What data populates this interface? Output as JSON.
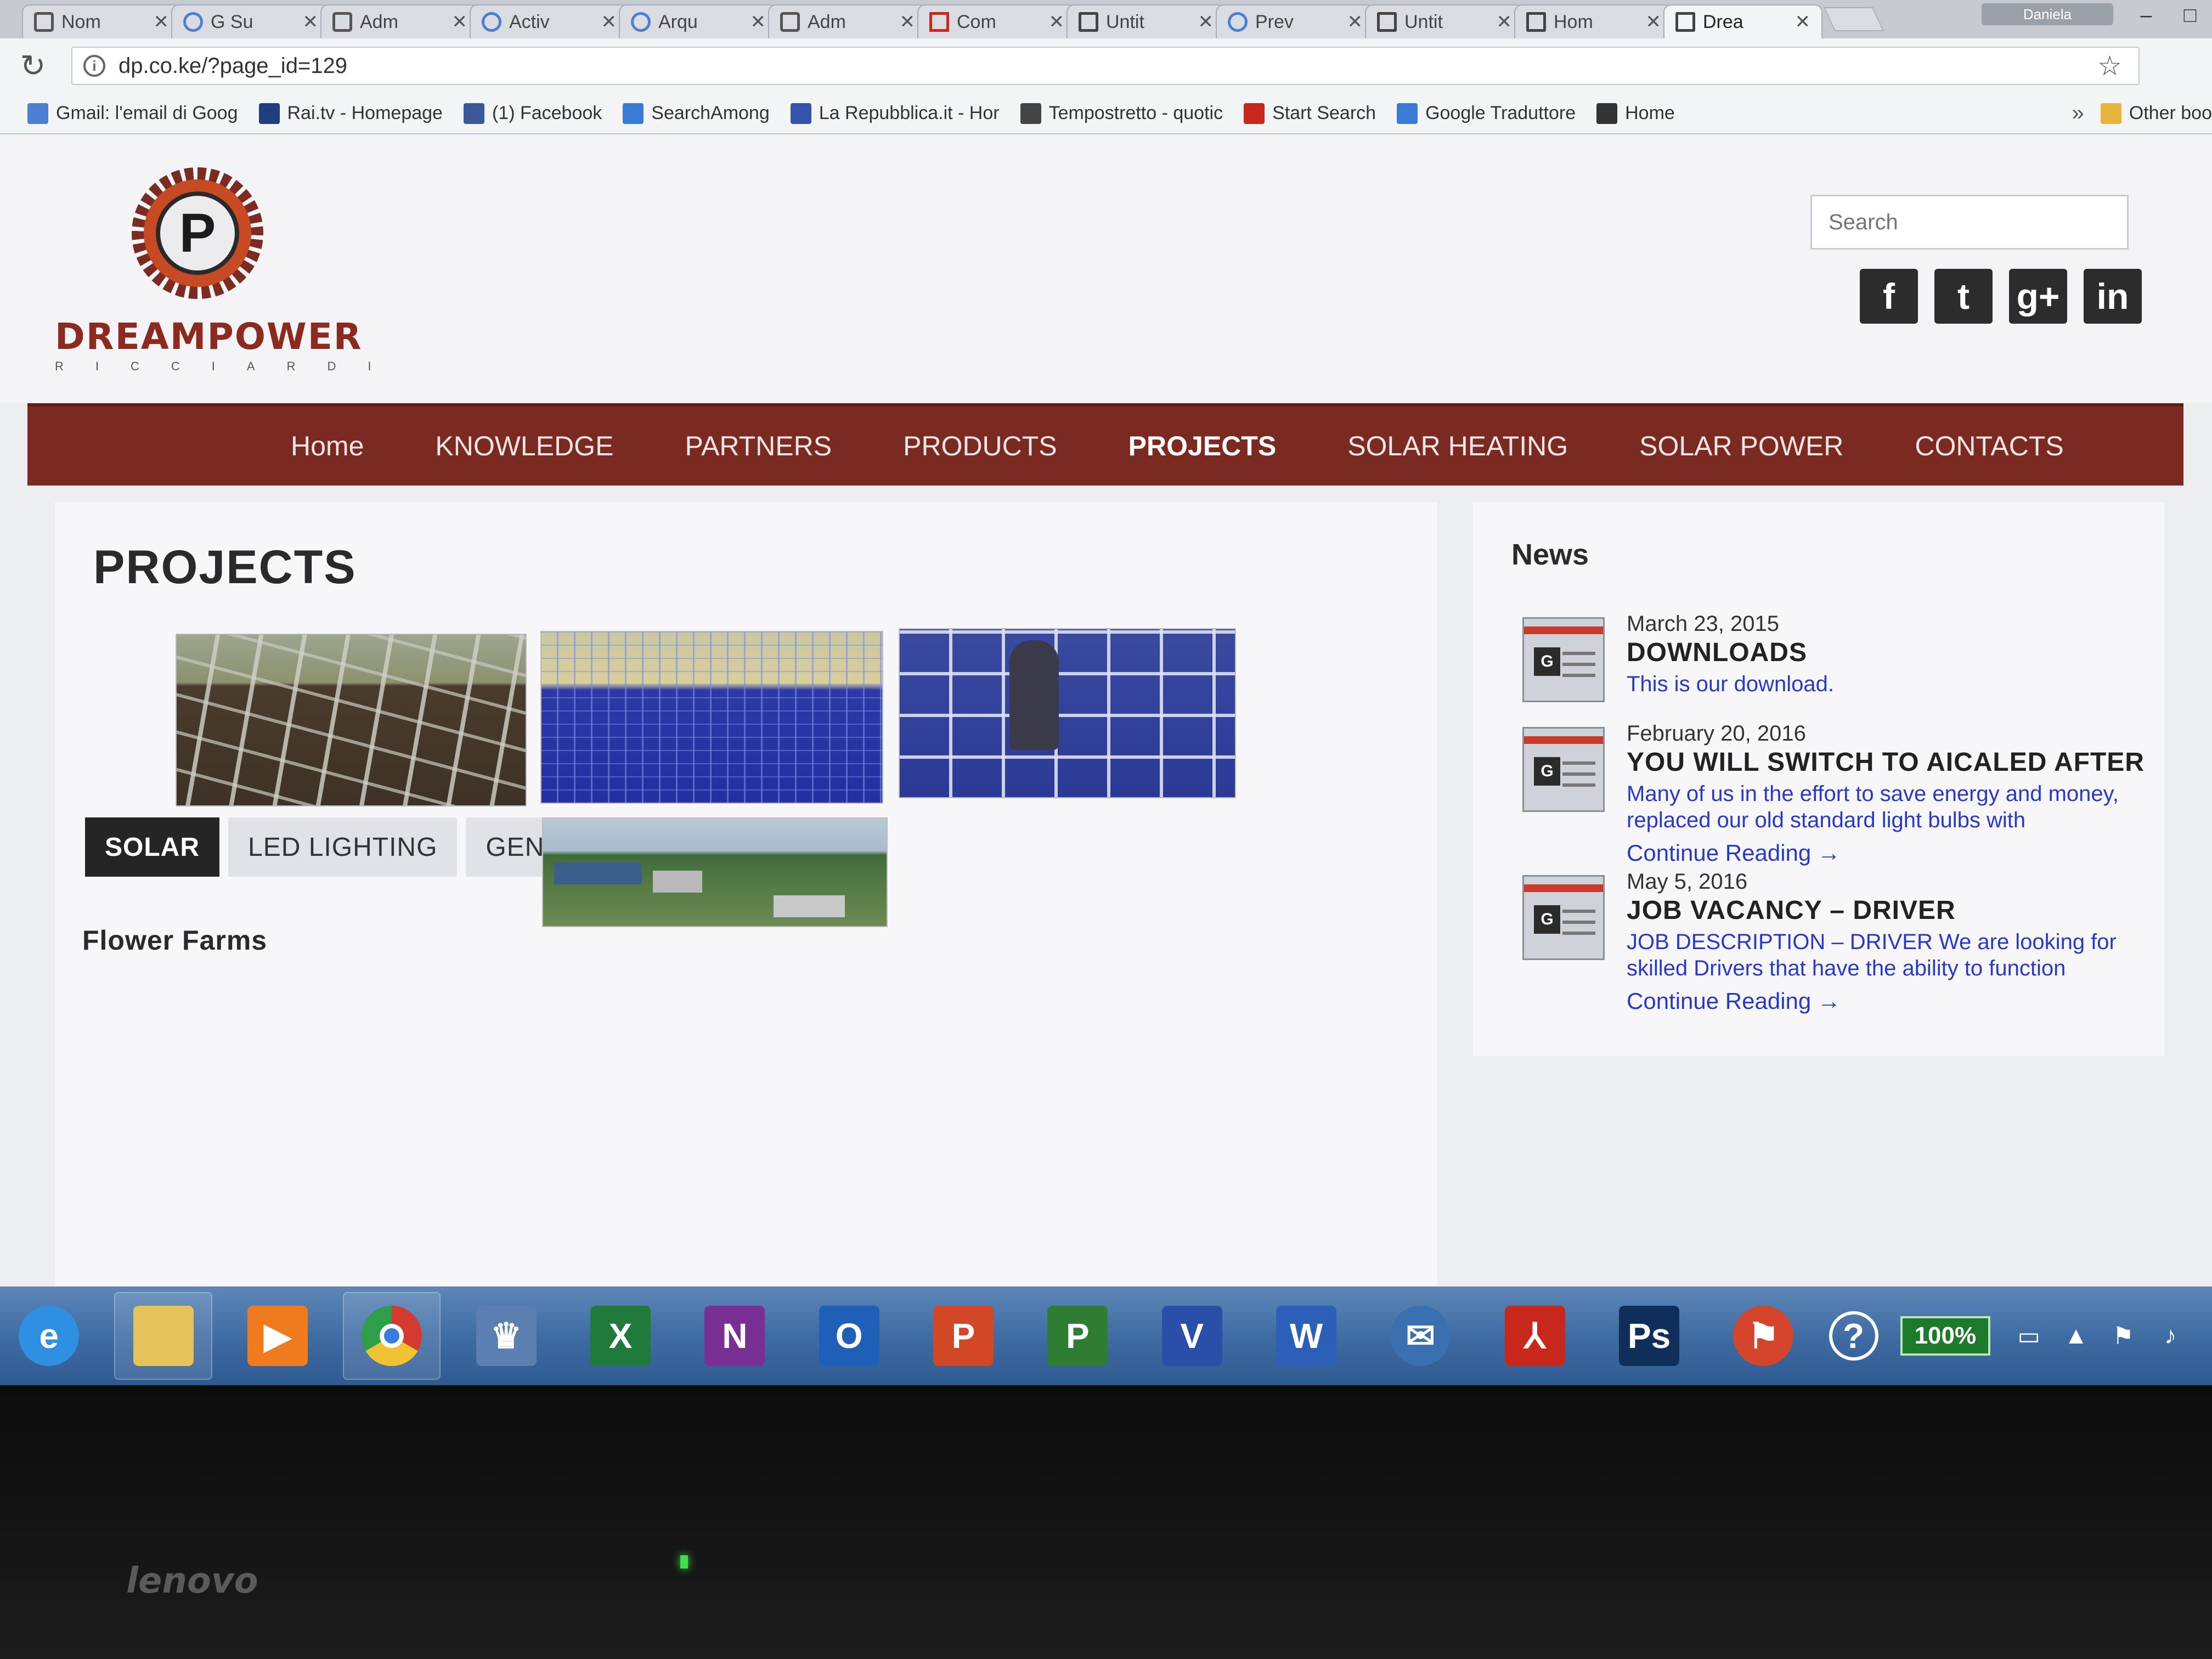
{
  "browser": {
    "tabs": [
      {
        "label": "Nom",
        "icon": "gear-icon"
      },
      {
        "label": "G Su",
        "icon": "google-icon"
      },
      {
        "label": "Adm",
        "icon": "github-icon"
      },
      {
        "label": "Activ",
        "icon": "google-icon"
      },
      {
        "label": "Arqu",
        "icon": "google-icon"
      },
      {
        "label": "Adm",
        "icon": "github-icon"
      },
      {
        "label": "Com",
        "icon": "pdf-icon"
      },
      {
        "label": "Untit",
        "icon": "page-icon"
      },
      {
        "label": "Prev",
        "icon": "google-icon"
      },
      {
        "label": "Untit",
        "icon": "page-icon"
      },
      {
        "label": "Hom",
        "icon": "page-icon"
      },
      {
        "label": "Drea",
        "icon": "document-icon",
        "active": true
      }
    ],
    "user_label": "Daniela",
    "url": "dp.co.ke/?page_id=129",
    "bookmarks": [
      {
        "label": "Gmail: l'email di Goog",
        "icon": "google-icon",
        "color": "#4a7fd4"
      },
      {
        "label": "Rai.tv - Homepage",
        "icon": "rai-icon",
        "color": "#1f3e7a"
      },
      {
        "label": "(1) Facebook",
        "icon": "facebook-icon",
        "color": "#3b5998"
      },
      {
        "label": "SearchAmong",
        "icon": "search-icon",
        "color": "#3a7bd5"
      },
      {
        "label": "La Repubblica.it - Hor",
        "icon": "repubblica-icon",
        "color": "#3354a8"
      },
      {
        "label": "Tempostretto - quotic",
        "icon": "ts-icon",
        "color": "#444444"
      },
      {
        "label": "Start Search",
        "icon": "ask-icon",
        "color": "#c8281c"
      },
      {
        "label": "Google Traduttore",
        "icon": "translate-icon",
        "color": "#3a7bd5"
      },
      {
        "label": "Home",
        "icon": "n-icon",
        "color": "#333333"
      }
    ],
    "more_label": "»",
    "other_bookmarks": "Other boo"
  },
  "site": {
    "logo": {
      "name": "DREAMPOWER",
      "sub": "RICCIARDI",
      "letter": "P"
    },
    "search_placeholder": "Search",
    "social": [
      "f",
      "t",
      "g+",
      "in"
    ],
    "nav": [
      {
        "label": "Home"
      },
      {
        "label": "KNOWLEDGE"
      },
      {
        "label": "PARTNERS"
      },
      {
        "label": "PRODUCTS"
      },
      {
        "label": "PROJECTS",
        "active": true
      },
      {
        "label": "SOLAR HEATING"
      },
      {
        "label": "SOLAR POWER"
      },
      {
        "label": "CONTACTS"
      }
    ],
    "page_title": "PROJECTS",
    "filters": [
      {
        "label": "SOLAR",
        "active": true
      },
      {
        "label": "LED LIGHTING"
      },
      {
        "label": "GENERATOR SETS"
      }
    ],
    "section_title": "Flower Farms",
    "news": {
      "title": "News",
      "items": [
        {
          "date": "March 23, 2015",
          "headline": "DOWNLOADS",
          "excerpt": "This is our download.",
          "more": ""
        },
        {
          "date": "February 20, 2016",
          "headline": "YOU WILL SWITCH TO AICALED AFTER",
          "excerpt": "Many of us in the effort to save energy and money, replaced our old standard light bulbs with",
          "more": "Continue Reading →"
        },
        {
          "date": "May 5, 2016",
          "headline": "JOB VACANCY – DRIVER",
          "excerpt": "JOB DESCRIPTION – DRIVER   We are looking for skilled Drivers that have the ability to function",
          "more": "Continue Reading →"
        }
      ]
    }
  },
  "taskbar": {
    "apps": [
      {
        "name": "internet-explorer-icon",
        "glyph": "e",
        "color": "#2f8fe0"
      },
      {
        "name": "file-explorer-icon",
        "glyph": "",
        "color": "#e6c25a"
      },
      {
        "name": "media-player-icon",
        "glyph": "▶",
        "color": "#f07a1e"
      },
      {
        "name": "chrome-icon",
        "glyph": "",
        "color": "#d43a2f"
      },
      {
        "name": "app-icon",
        "glyph": "♛",
        "color": "#5a7fb0"
      },
      {
        "name": "excel-icon",
        "glyph": "X",
        "color": "#1f7a3c"
      },
      {
        "name": "onenote-icon",
        "glyph": "N",
        "color": "#7a2f94"
      },
      {
        "name": "outlook-icon",
        "glyph": "O",
        "color": "#1f5fb8"
      },
      {
        "name": "powerpoint-icon",
        "glyph": "P",
        "color": "#d24726"
      },
      {
        "name": "project-icon",
        "glyph": "P",
        "color": "#2e7d32"
      },
      {
        "name": "visio-icon",
        "glyph": "V",
        "color": "#2a4fa8"
      },
      {
        "name": "word-icon",
        "glyph": "W",
        "color": "#2b5fb8"
      },
      {
        "name": "thunderbird-icon",
        "glyph": "✉",
        "color": "#3a6fb0"
      },
      {
        "name": "acrobat-icon",
        "glyph": "⅄",
        "color": "#c8281c"
      },
      {
        "name": "photoshop-icon",
        "glyph": "Ps",
        "color": "#0f2f5a"
      },
      {
        "name": "action-center-icon",
        "glyph": "⚑",
        "color": "#d4452c"
      }
    ],
    "battery": "100%",
    "help": "?"
  },
  "bezel": {
    "brand": "lenovo"
  }
}
